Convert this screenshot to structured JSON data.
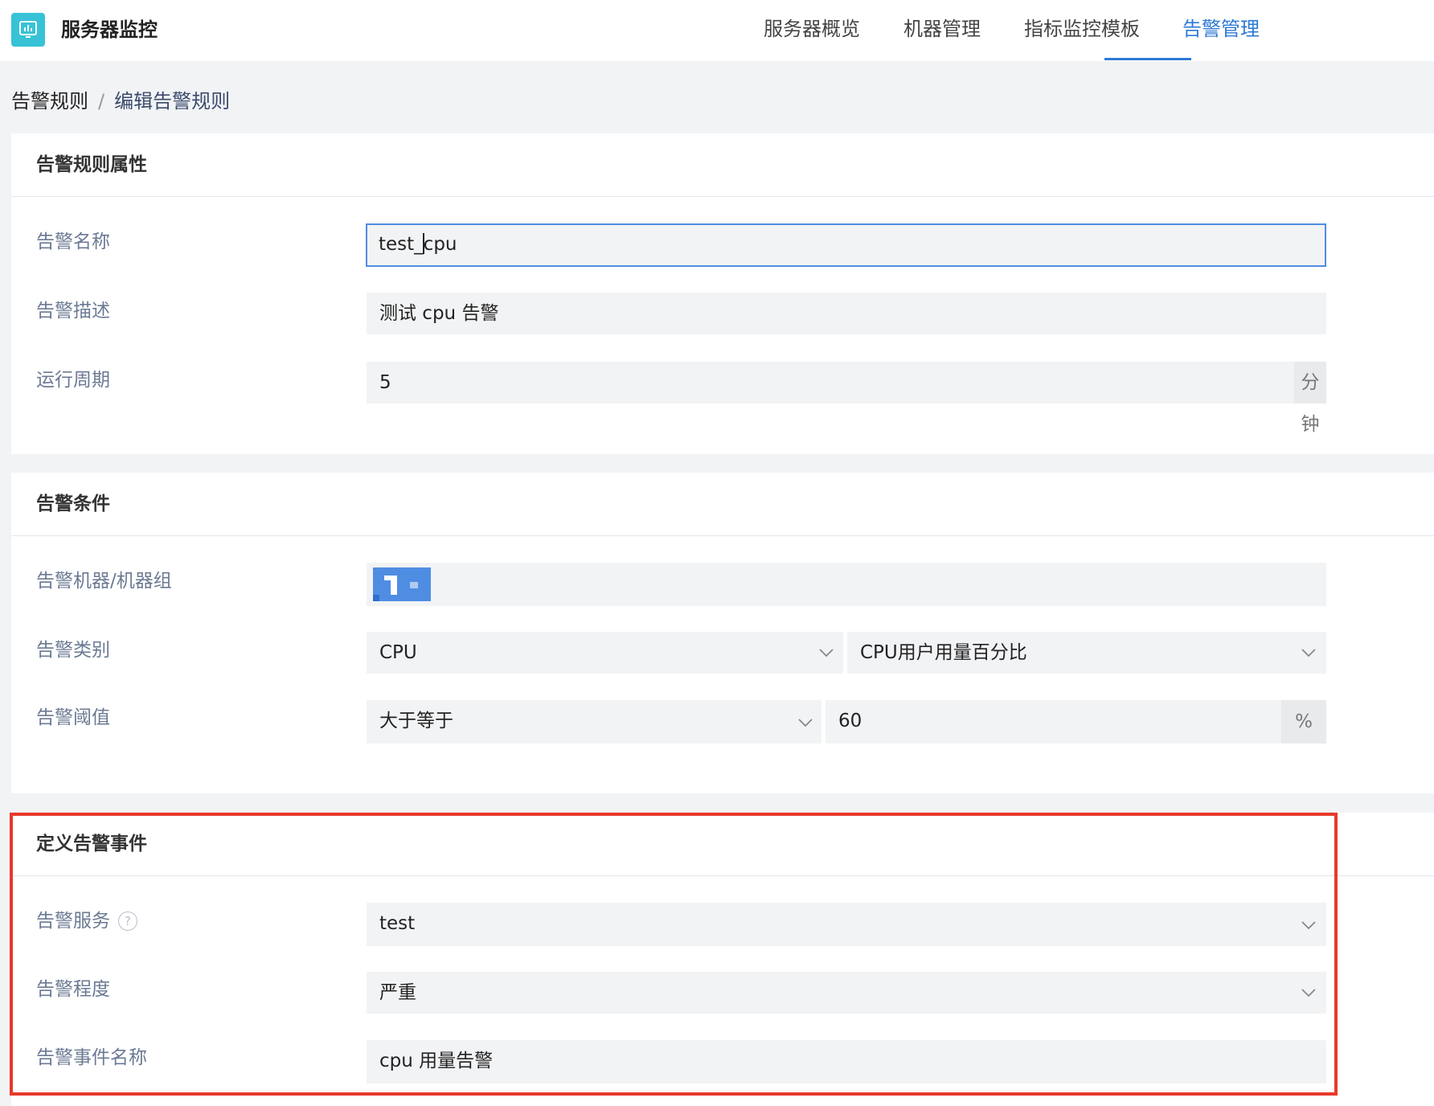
{
  "header": {
    "app_title": "服务器监控",
    "logo_icon": "monitor-chart-icon",
    "nav": [
      {
        "label": "服务器概览",
        "active": false
      },
      {
        "label": "机器管理",
        "active": false
      },
      {
        "label": "指标监控模板",
        "active": false
      },
      {
        "label": "告警管理",
        "active": true
      }
    ],
    "accent_color": "#2d79d6"
  },
  "breadcrumb": {
    "root": "告警规则",
    "separator": "/",
    "current": "编辑告警规则"
  },
  "rule_properties": {
    "title": "告警规则属性",
    "name_label": "告警名称",
    "name_value_before_cursor": "test_",
    "name_value_after_cursor": "cpu",
    "desc_label": "告警描述",
    "desc_value": "测试 cpu 告警",
    "period_label": "运行周期",
    "period_value": "5",
    "period_unit": "分钟"
  },
  "conditions": {
    "title": "告警条件",
    "machine_label": "告警机器/机器组",
    "category_label": "告警类别",
    "category_value": "CPU",
    "metric_value": "CPU用户用量百分比",
    "threshold_label": "告警阈值",
    "operator_value": "大于等于",
    "threshold_value": "60",
    "threshold_unit": "%"
  },
  "event": {
    "title": "定义告警事件",
    "service_label": "告警服务",
    "service_help": "?",
    "service_value": "test",
    "severity_label": "告警程度",
    "severity_value": "严重",
    "event_name_label": "告警事件名称",
    "event_name_value": "cpu 用量告警"
  }
}
